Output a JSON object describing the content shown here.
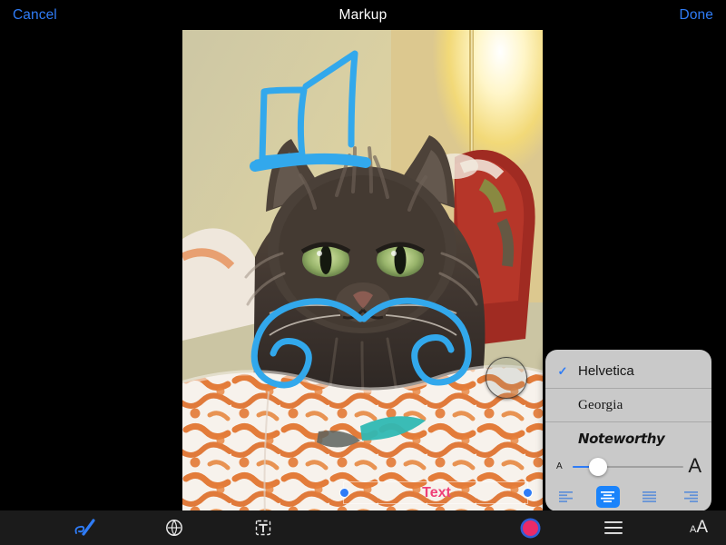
{
  "navbar": {
    "cancel_label": "Cancel",
    "title": "Markup",
    "done_label": "Done"
  },
  "canvas": {
    "description": "Photo of a long-haired tabby cat on an orange-and-white patterned quilt with a lamp glow behind",
    "annotations": [
      {
        "name": "top-hat-doodle",
        "color": "#32a8ec",
        "shape": "hand-drawn top hat above cat head"
      },
      {
        "name": "mustache-doodle",
        "color": "#32a8ec",
        "shape": "hand-drawn curly handlebar mustache over cat muzzle"
      }
    ]
  },
  "text_overlay": {
    "value": "Text",
    "color": "#ef3f77",
    "selected": true
  },
  "popover": {
    "fonts": [
      {
        "label": "Helvetica",
        "selected": true,
        "check_glyph": "✓"
      },
      {
        "label": "Georgia",
        "selected": false,
        "check_glyph": ""
      },
      {
        "label": "Noteworthy",
        "selected": false,
        "check_glyph": ""
      }
    ],
    "size_slider": {
      "small_label": "A",
      "large_label": "A",
      "value_percent": 22,
      "fill_color": "#2f7cf6"
    },
    "alignment": {
      "options": [
        {
          "name": "align-left",
          "active": false
        },
        {
          "name": "align-center",
          "active": true
        },
        {
          "name": "align-justify",
          "active": false
        },
        {
          "name": "align-right",
          "active": false
        }
      ],
      "active_color": "#1a83fb"
    },
    "background_color": "#c9c9c9"
  },
  "toolbar": {
    "items": [
      {
        "name": "sketch-pen-icon",
        "active": true,
        "color": "#2f7cf6"
      },
      {
        "name": "loupe-icon",
        "active": false,
        "color": "#e8e8e8"
      },
      {
        "name": "text-box-icon",
        "active": false,
        "color": "#e8e8e8"
      },
      {
        "name": "color-swatch",
        "active": false,
        "color": "#ea2a68"
      },
      {
        "name": "menu-icon",
        "active": false,
        "color": "#e8e8e8"
      },
      {
        "name": "text-size-icon",
        "active": false,
        "color": "#e8e8e8",
        "label_small": "A",
        "label_large": "A"
      }
    ]
  }
}
